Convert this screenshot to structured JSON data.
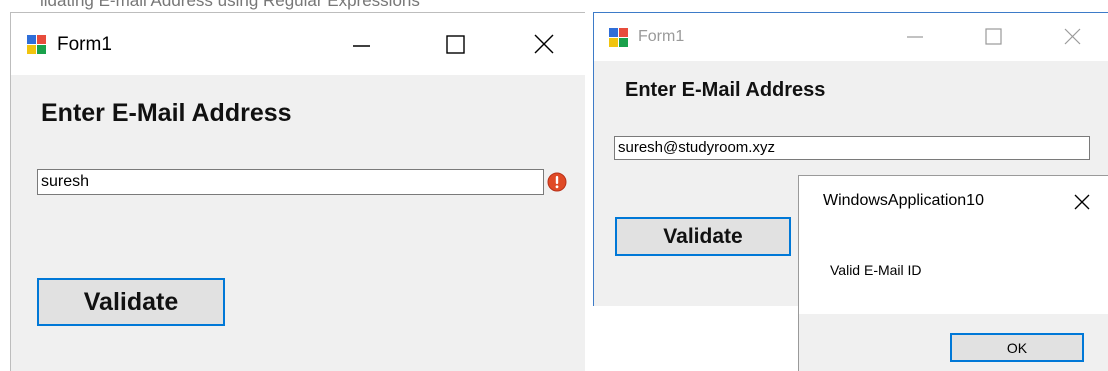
{
  "background_text": "lidating E-mail Address using Regular Expressions",
  "form_before": {
    "title": "Form1",
    "heading": "Enter E-Mail Address",
    "email_value": "suresh",
    "button_label": "Validate",
    "error_icon": "error-exclamation-icon"
  },
  "form_after": {
    "title": "Form1",
    "heading": "Enter E-Mail Address",
    "email_value": "suresh@studyroom.xyz",
    "button_label": "Validate"
  },
  "message_box": {
    "title": "WindowsApplication10",
    "message": "Valid E-Mail ID",
    "ok_label": "OK"
  },
  "colors": {
    "accent": "#0078d7",
    "error": "#e04a26",
    "window_bg": "#f0f0f0"
  }
}
